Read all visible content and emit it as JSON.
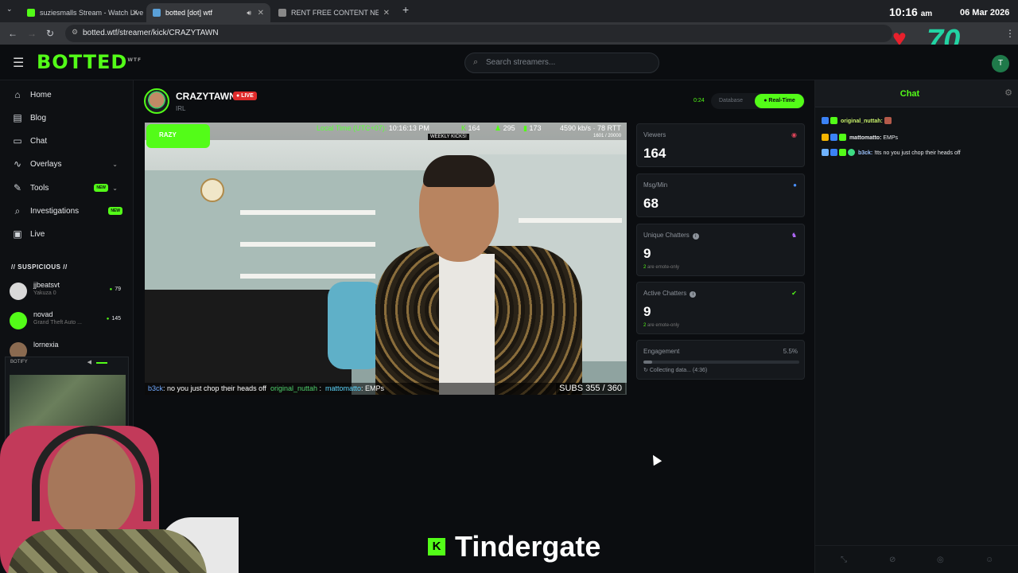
{
  "browser": {
    "tabs": [
      {
        "title": "suziesmalls Stream - Watch Live",
        "color": "#53fc18"
      },
      {
        "title": "botted [dot] wtf",
        "color": "#5aa0d8"
      },
      {
        "title": "RENT FREE CONTENT NETWORK",
        "color": "#888888"
      }
    ],
    "url": "botted.wtf/streamer/kick/CRAZYTAWN",
    "clock": "10:16",
    "ampm": "am",
    "date": "06 Mar 2026",
    "heart_count": "70"
  },
  "site": {
    "logo": "BOTTED",
    "logo_sup": "WTF",
    "search_placeholder": "Search streamers...",
    "user_initial": "T"
  },
  "sidebar": {
    "items": [
      {
        "label": "Home",
        "icon": "home-icon"
      },
      {
        "label": "Blog",
        "icon": "document-icon"
      },
      {
        "label": "Chat",
        "icon": "chat-bubble-icon"
      },
      {
        "label": "Overlays",
        "icon": "pulse-icon"
      },
      {
        "label": "Tools",
        "icon": "wrench-icon",
        "badge": "NEW"
      },
      {
        "label": "Investigations",
        "icon": "search-icon",
        "badge": "NEW"
      },
      {
        "label": "Live",
        "icon": "tv-icon"
      }
    ],
    "suspicious_title": "// SUSPICIOUS //",
    "suspicious": [
      {
        "name": "jjbeatsvt",
        "sub": "Yakuza 0",
        "count": "79"
      },
      {
        "name": "novad",
        "sub": "Grand Theft Auto ...",
        "count": "145"
      },
      {
        "name": "lornexia",
        "sub": "",
        "count": ""
      }
    ],
    "botify_label": "BOTIFY"
  },
  "streamer": {
    "name": "CRAZYTAWN",
    "live": "LIVE",
    "category": "IRL",
    "timer": "0:24",
    "mode_database": "Database",
    "mode_realtime": "Real-Time"
  },
  "video": {
    "badge": "RAZY",
    "local_time_label": "Local Time (UTC+07):",
    "local_time": "10:16:13 PM",
    "viewers": "164",
    "followers": "295",
    "chatters": "173",
    "bitrate": "4590 kb/s · 78 RTT",
    "weekly_kicks": "WEEKLY KICKS!",
    "weekly_count": "1601 / 20000",
    "ticker_user1": "b3ck",
    "ticker_msg1": ": no you just chop their heads off",
    "ticker_user2": "original_nuttah",
    "ticker_user3": "mattomatto",
    "ticker_msg3": ": EMPs",
    "subs": "SUBS  355 / 360"
  },
  "stats": {
    "viewers_label": "Viewers",
    "viewers": "164",
    "msgmin_label": "Msg/Min",
    "msgmin": "68",
    "unique_label": "Unique Chatters",
    "unique": "9",
    "unique_emote": "2",
    "unique_emote_text": "are emote-only",
    "active_label": "Active Chatters",
    "active": "9",
    "active_emote": "2",
    "active_emote_text": "are emote-only",
    "engagement_label": "Engagement",
    "engagement_pct": "5.5%",
    "engagement_fraction": 0.055,
    "engagement_status": "Collecting data... (4:36)"
  },
  "chat": {
    "title": "Chat",
    "messages": [
      {
        "user": "original_nuttah:",
        "text": "",
        "color": "#c7f06a"
      },
      {
        "user": "mattomatto:",
        "text": "EMPs",
        "color": "#e6e8eb"
      },
      {
        "user": "b3ck:",
        "text": "!tts no you just chop their heads off",
        "color": "#9cc4ff"
      }
    ]
  },
  "overlay_text": "Tindergate",
  "colors": {
    "accent": "#53fc18",
    "live": "#e02b2b"
  }
}
